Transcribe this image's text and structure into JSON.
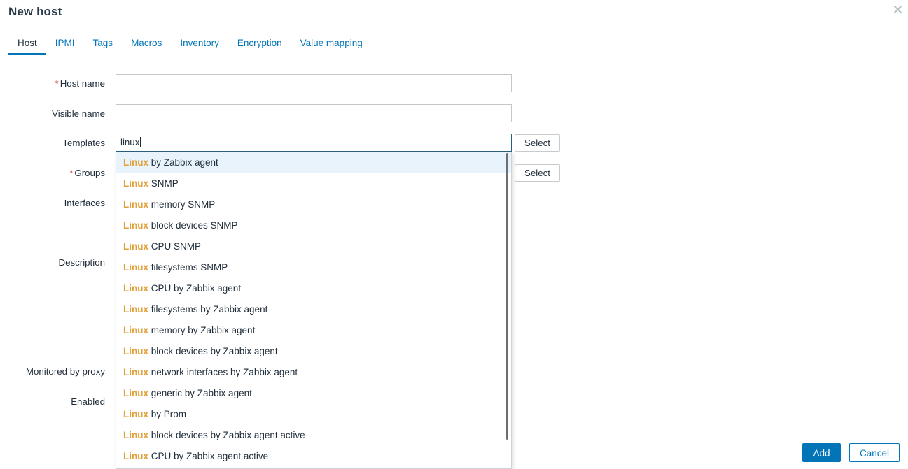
{
  "dialog": {
    "title": "New host",
    "close_icon": "close-icon"
  },
  "tabs": [
    {
      "label": "Host",
      "active": true
    },
    {
      "label": "IPMI",
      "active": false
    },
    {
      "label": "Tags",
      "active": false
    },
    {
      "label": "Macros",
      "active": false
    },
    {
      "label": "Inventory",
      "active": false
    },
    {
      "label": "Encryption",
      "active": false
    },
    {
      "label": "Value mapping",
      "active": false
    }
  ],
  "form": {
    "host_name": {
      "label": "Host name",
      "required": true,
      "value": ""
    },
    "visible_name": {
      "label": "Visible name",
      "required": false,
      "value": ""
    },
    "templates": {
      "label": "Templates",
      "required": false,
      "value": "linux",
      "select_label": "Select"
    },
    "groups": {
      "label": "Groups",
      "required": true,
      "value": "",
      "select_label": "Select"
    },
    "interfaces": {
      "label": "Interfaces",
      "required": false
    },
    "description": {
      "label": "Description",
      "required": false
    },
    "monitored_by_proxy": {
      "label": "Monitored by proxy",
      "required": false
    },
    "enabled": {
      "label": "Enabled",
      "required": false
    }
  },
  "suggestions": {
    "query": "linux",
    "match_prefix": "Linux",
    "selected_index": 0,
    "items": [
      {
        "match": "Linux",
        "rest": " by Zabbix agent"
      },
      {
        "match": "Linux",
        "rest": " SNMP"
      },
      {
        "match": "Linux",
        "rest": " memory SNMP"
      },
      {
        "match": "Linux",
        "rest": " block devices SNMP"
      },
      {
        "match": "Linux",
        "rest": " CPU SNMP"
      },
      {
        "match": "Linux",
        "rest": " filesystems SNMP"
      },
      {
        "match": "Linux",
        "rest": " CPU by Zabbix agent"
      },
      {
        "match": "Linux",
        "rest": " filesystems by Zabbix agent"
      },
      {
        "match": "Linux",
        "rest": " memory by Zabbix agent"
      },
      {
        "match": "Linux",
        "rest": " block devices by Zabbix agent"
      },
      {
        "match": "Linux",
        "rest": " network interfaces by Zabbix agent"
      },
      {
        "match": "Linux",
        "rest": " generic by Zabbix agent"
      },
      {
        "match": "Linux",
        "rest": " by Prom"
      },
      {
        "match": "Linux",
        "rest": " block devices by Zabbix agent active"
      },
      {
        "match": "Linux",
        "rest": " CPU by Zabbix agent active"
      }
    ]
  },
  "footer": {
    "add_label": "Add",
    "cancel_label": "Cancel"
  },
  "colors": {
    "accent": "#0275b8",
    "match_highlight": "#e2a039",
    "selected_row": "#e8f3fb",
    "required_asterisk": "#d23b3b",
    "text": "#1f2c39"
  }
}
